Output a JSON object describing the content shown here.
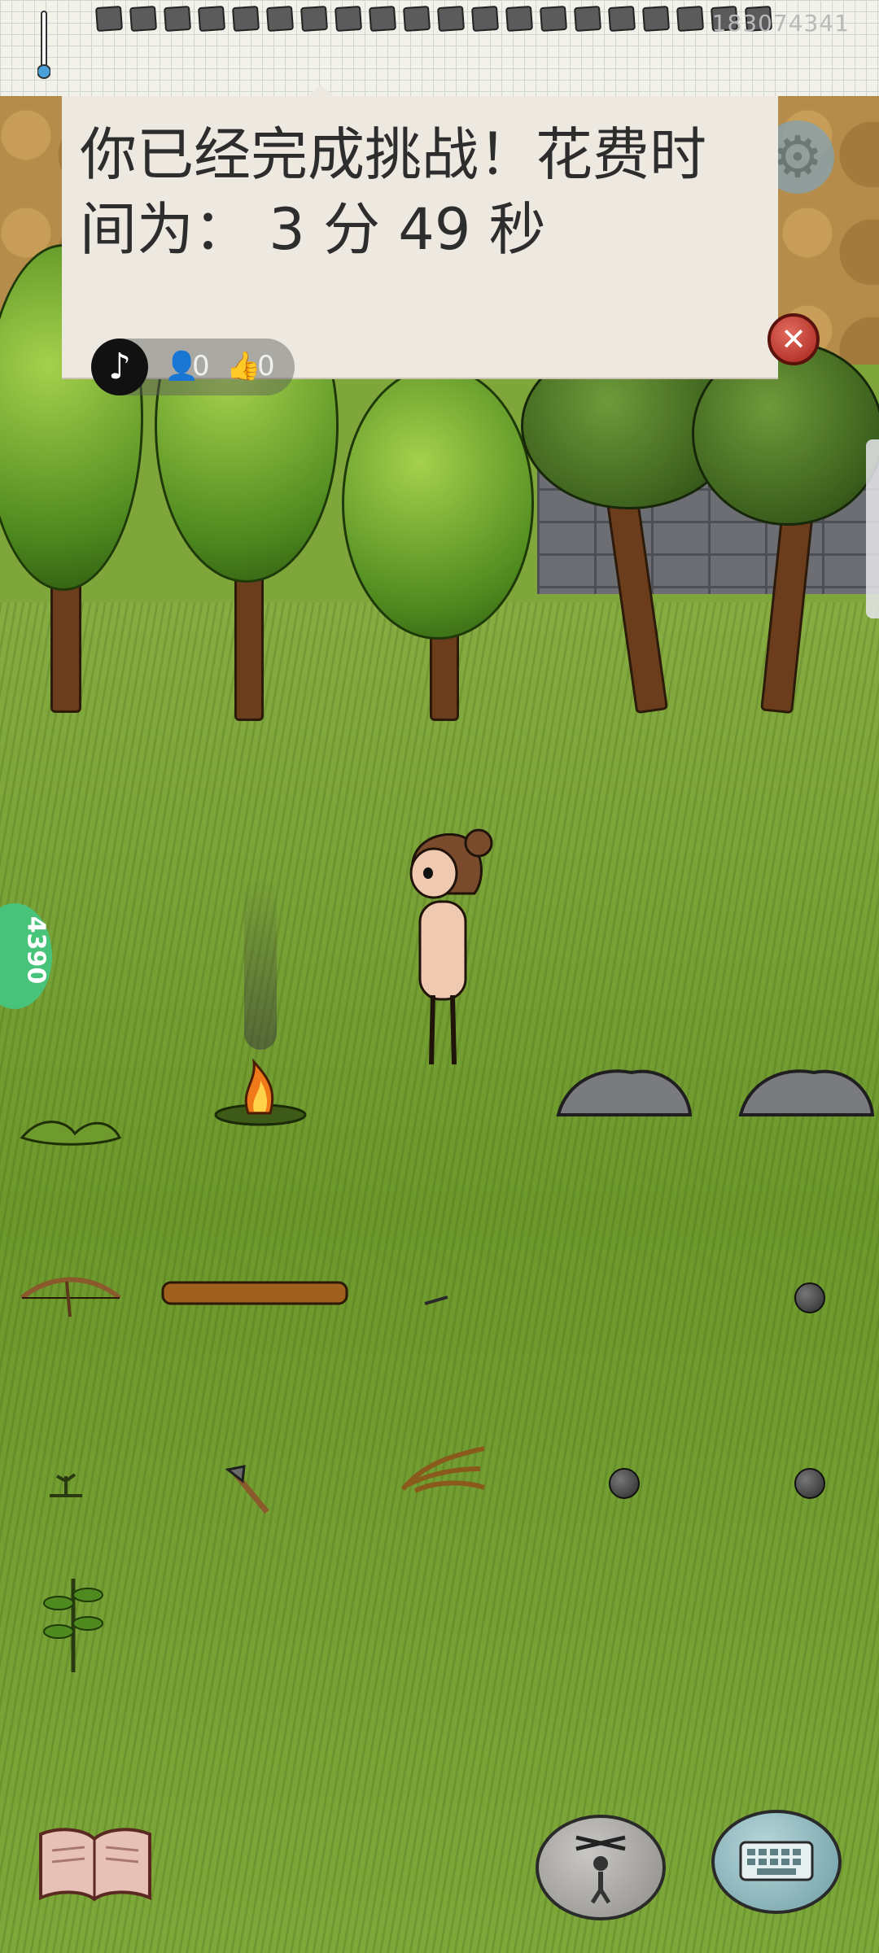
{
  "status_bar": {
    "watermark": "183074341"
  },
  "popup": {
    "message": "你已经完成挑战！花费时间为： 3 分 49 秒",
    "close_icon": "close-x-icon"
  },
  "settings": {
    "icon": "gear-icon"
  },
  "social": {
    "app_icon": "♪",
    "followers": "0",
    "likes": "0"
  },
  "side_badge": {
    "text": "4390"
  },
  "bottom_toolbar": {
    "journal_icon": "book-icon",
    "puppet_icon": "puppet-icon",
    "keyboard_icon": "keyboard-icon"
  }
}
